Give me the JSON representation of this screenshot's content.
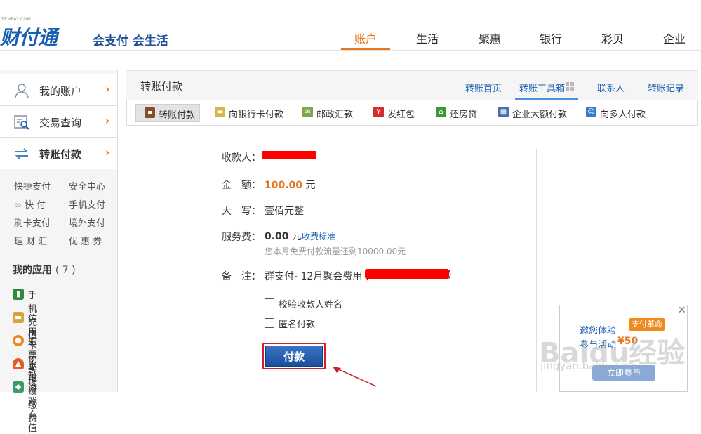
{
  "header": {
    "logo_domain": "TENPAY.COM",
    "logo_text": "财付通",
    "slogan": "会支付 会生活",
    "nav": [
      "账户",
      "生活",
      "聚惠",
      "银行",
      "彩贝",
      "企业"
    ],
    "active_nav": "账户"
  },
  "sidebar": {
    "account_items": [
      {
        "label": "我的账户",
        "icon": "user-icon"
      },
      {
        "label": "交易查询",
        "icon": "search-list-icon"
      },
      {
        "label": "转账付款",
        "icon": "transfer-icon"
      }
    ],
    "chevron": "›",
    "quick_links": [
      "快捷支付",
      "安全中心",
      "∞ 快 付",
      "手机支付",
      "刷卡支付",
      "境外支付",
      "理 财 汇",
      "优 惠 券"
    ],
    "apps_title": "我的应用",
    "apps_count": "( 7 )",
    "apps": [
      {
        "label": "手机充值",
        "icon": "phone-icon"
      },
      {
        "label": "信用卡还款",
        "icon": "credit-card-icon"
      },
      {
        "label": "彩票卖场",
        "icon": "lottery-icon"
      },
      {
        "label": "水电煤缴费",
        "icon": "flame-icon"
      },
      {
        "label": "游戏充值",
        "icon": "gamepad-icon"
      }
    ]
  },
  "panel": {
    "title": "转账付款",
    "links": [
      "转账首页",
      "转账工具箱",
      "联系人",
      "转账记录"
    ]
  },
  "tabs": [
    {
      "label": "转账付款",
      "icon": "wallet-icon"
    },
    {
      "label": "向银行卡付款",
      "icon": "bank-card-icon"
    },
    {
      "label": "邮政汇款",
      "icon": "mail-icon"
    },
    {
      "label": "发红包",
      "icon": "red-envelope-icon"
    },
    {
      "label": "还房贷",
      "icon": "house-icon"
    },
    {
      "label": "企业大额付款",
      "icon": "building-icon"
    },
    {
      "label": "向多人付款",
      "icon": "group-icon"
    }
  ],
  "form": {
    "payee_label": "收款人：",
    "amount_label": "金　额：",
    "amount_value": "100.00",
    "amount_unit": "元",
    "uppercase_label": "大　写：",
    "uppercase_value": "壹佰元整",
    "fee_label": "服务费：",
    "fee_value": "0.00",
    "fee_unit": "元",
    "fee_link": "收费标准",
    "fee_hint": "您本月免费付款流量还剩10000.00元",
    "remark_label": "备　注：",
    "remark_value": "群支付- 12月聚会费用 (",
    "remark_close": ")",
    "check_name_label": "校验收款人姓名",
    "anonymous_label": "匿名付款",
    "pay_button": "付款"
  },
  "ad": {
    "close": "✕",
    "line1": "邀您体验",
    "line2": "参与活动",
    "badge": "支付革命",
    "amount": "¥50",
    "button": "立即参与"
  },
  "watermark": {
    "main": "Baidu经验",
    "url": "jingyan.baidu.com"
  },
  "colors": {
    "accent": "#e8761d",
    "link": "#1a5fb4",
    "redaction": "#ff0000"
  }
}
